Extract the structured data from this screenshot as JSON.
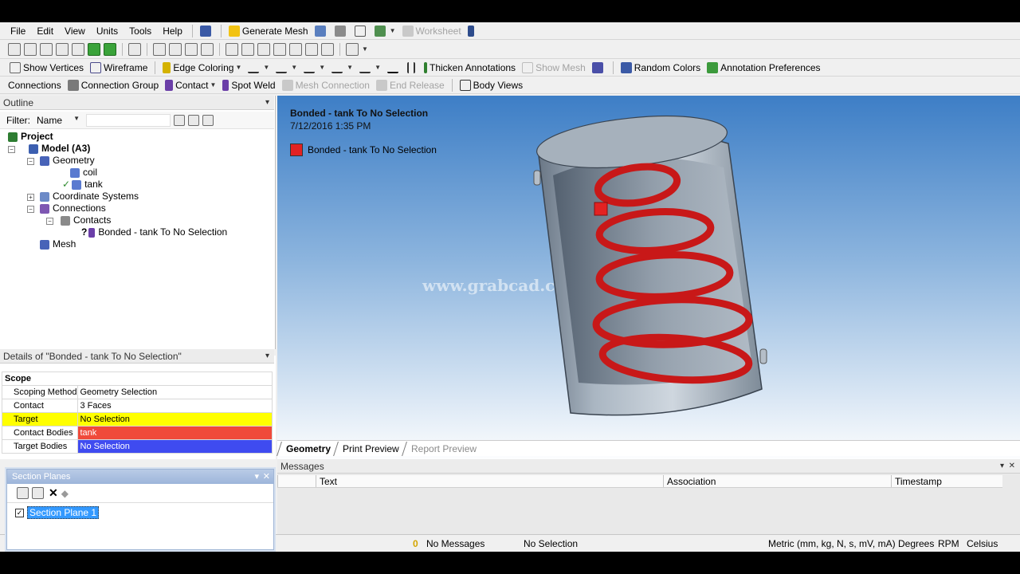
{
  "menu": [
    "File",
    "Edit",
    "View",
    "Units",
    "Tools",
    "Help"
  ],
  "toolbar1": {
    "generate_mesh": "Generate Mesh",
    "worksheet": "Worksheet"
  },
  "toolbar3": {
    "show_vertices": "Show Vertices",
    "wireframe": "Wireframe",
    "edge_coloring": "Edge Coloring",
    "thicken_annotations": "Thicken Annotations",
    "show_mesh": "Show Mesh",
    "random_colors": "Random Colors",
    "annotation_preferences": "Annotation Preferences"
  },
  "toolbar4": {
    "connections": "Connections",
    "connection_group": "Connection Group",
    "contact": "Contact",
    "spot_weld": "Spot Weld",
    "mesh_connection": "Mesh Connection",
    "end_release": "End Release",
    "body_views": "Body Views"
  },
  "outline": {
    "title": "Outline",
    "filter_label": "Filter:",
    "filter_value": "Name",
    "tree": {
      "project": "Project",
      "model": "Model (A3)",
      "geometry": "Geometry",
      "coil": "coil",
      "tank": "tank",
      "coordinate_systems": "Coordinate Systems",
      "connections": "Connections",
      "contacts": "Contacts",
      "bonded": "Bonded - tank To No Selection",
      "mesh": "Mesh"
    }
  },
  "details": {
    "title": "Details of \"Bonded - tank To No Selection\"",
    "section": "Scope",
    "rows": [
      {
        "label": "Scoping Method",
        "value": "Geometry Selection",
        "color": "#ffffff"
      },
      {
        "label": "Contact",
        "value": "3 Faces",
        "color": "#ffffff"
      },
      {
        "label": "Target",
        "value": "No Selection",
        "color": "#ffff00"
      },
      {
        "label": "Contact Bodies",
        "value": "tank",
        "color": "#f04a3a"
      },
      {
        "label": "Target Bodies",
        "value": "No Selection",
        "color": "#3f4bf0"
      }
    ]
  },
  "viewport": {
    "title": "Bonded - tank To No Selection",
    "date": "7/12/2016 1:35 PM",
    "legend": "Bonded - tank To No Selection",
    "legend_color": "#e32222",
    "watermark": "www.grabcad.com"
  },
  "view_tabs": [
    "Geometry",
    "Print Preview",
    "Report Preview"
  ],
  "messages": {
    "title": "Messages",
    "columns": [
      "Text",
      "Association",
      "Timestamp"
    ]
  },
  "section_planes": {
    "title": "Section Planes",
    "item": "Section Plane 1"
  },
  "status": {
    "messages": "No Messages",
    "selection": "No Selection",
    "units": "Metric (mm, kg, N, s, mV, mA)",
    "angle": "Degrees",
    "rpm": "RPM",
    "temp": "Celsius"
  }
}
